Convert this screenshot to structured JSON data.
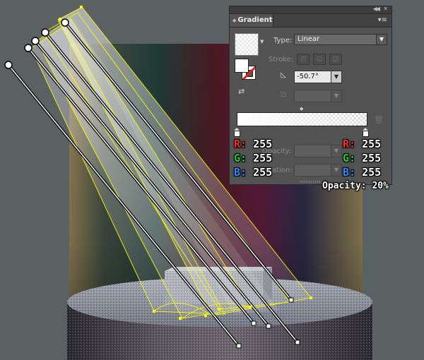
{
  "panel": {
    "tab_title": "Gradient",
    "type_label": "Type:",
    "type_value": "Linear",
    "stroke_label": "Stroke:",
    "angle_value": "-50.7°",
    "opacity_label": "Opacity:",
    "location_label": "Location:",
    "icons": [
      "collapse-icon",
      "close-icon",
      "panel-menu-icon",
      "angle-icon",
      "aspect-ratio-icon",
      "trash-icon",
      "reverse-gradient-icon"
    ]
  },
  "stops": {
    "left": {
      "r_key": "R:",
      "r": "255",
      "g_key": "G:",
      "g": "255",
      "b_key": "B:",
      "b": "255"
    },
    "right": {
      "r_key": "R:",
      "r": "255",
      "g_key": "G:",
      "g": "255",
      "b_key": "B:",
      "b": "255"
    }
  },
  "opacity_note": "Opacity: 20%",
  "colors": {
    "background": "#5b6163",
    "selection": "#ffff00",
    "r_label": "#ff2a2a",
    "g_label": "#27c93a",
    "b_label": "#2a8cff"
  }
}
